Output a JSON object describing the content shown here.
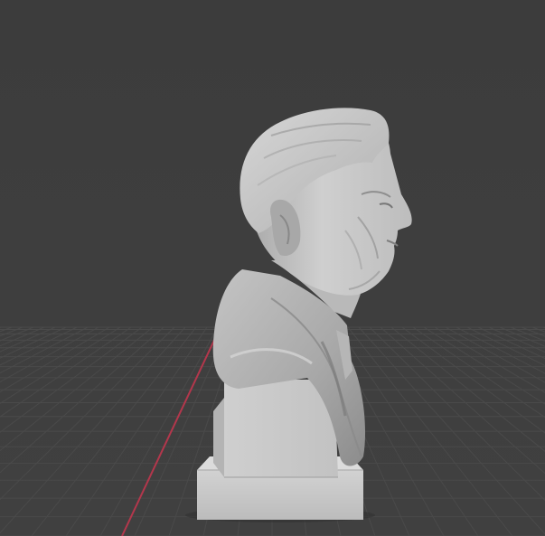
{
  "viewport": {
    "mode": "3d-viewport",
    "shading": "solid",
    "background_color": "#3d3d3d",
    "grid_line_color": "#4a4a4a",
    "x_axis_color": "#b3374c"
  },
  "object": {
    "type": "bust-sculpture",
    "base_color": "#c8c8c8",
    "shadow_color": "#8e8e8e"
  }
}
